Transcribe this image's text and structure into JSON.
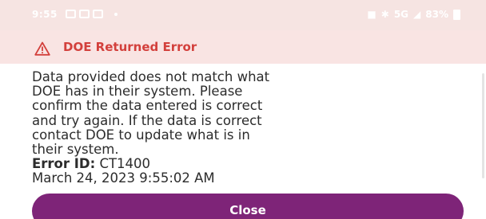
{
  "status_bar": {
    "time": "9:55",
    "network": "5G",
    "battery": "83%"
  },
  "dialog": {
    "title": "DOE Returned Error",
    "message_lines": [
      "Data provided does not match what",
      "DOE has in their system. Please",
      "confirm the data entered is correct",
      "and try again. If the data is correct",
      "contact DOE to update what is in",
      "their system."
    ],
    "error_id_label": "Error ID:",
    "error_id_value": "CT1400",
    "timestamp": "March 24, 2023 9:55:02 AM",
    "close_label": "Close"
  },
  "colors": {
    "error_red": "#d3403c",
    "header_bg": "#f9e4e3",
    "button_purple": "#7e2478"
  }
}
